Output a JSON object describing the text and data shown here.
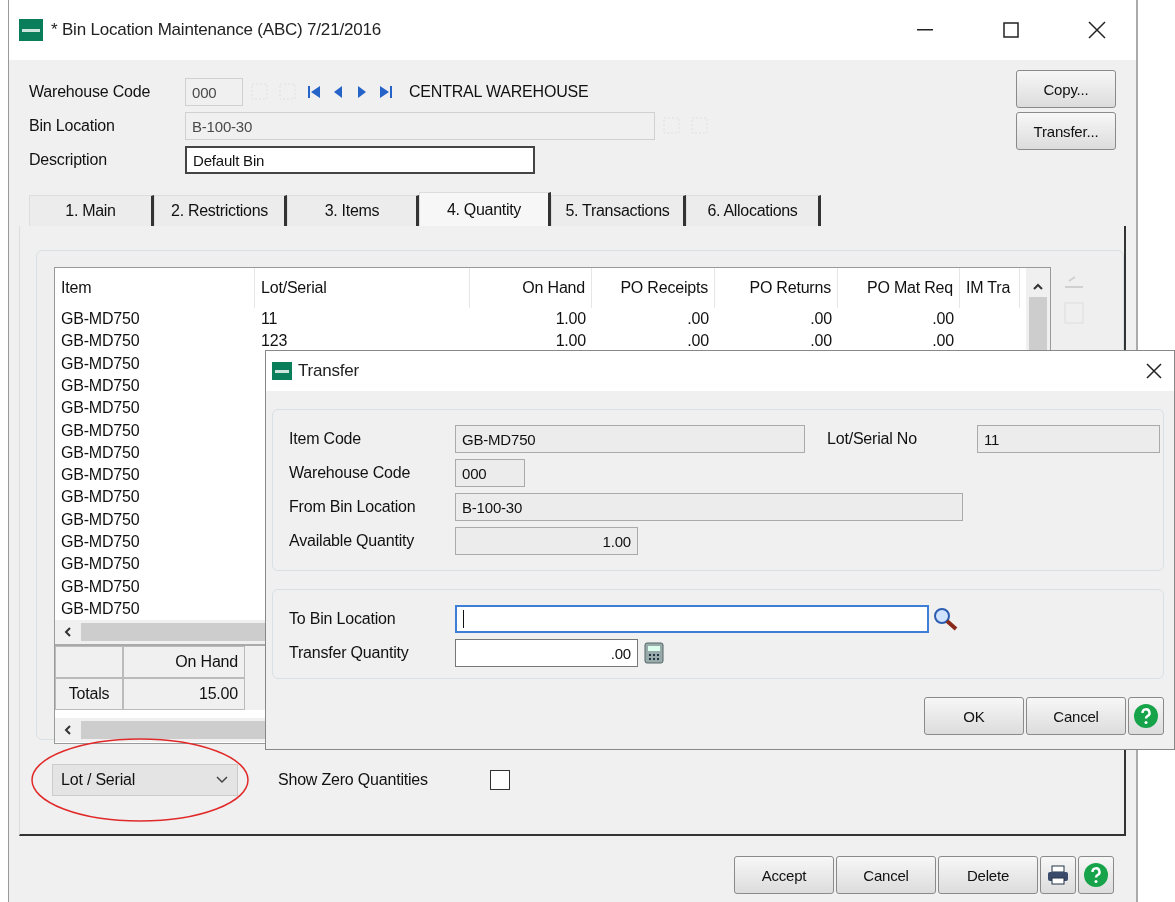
{
  "window": {
    "title": "* Bin Location Maintenance (ABC) 7/21/2016"
  },
  "header": {
    "warehouse_code": {
      "label": "Warehouse Code",
      "value": "000",
      "name": "CENTRAL WAREHOUSE"
    },
    "bin_location": {
      "label": "Bin Location",
      "value": "B-100-30"
    },
    "description": {
      "label": "Description",
      "value": "Default Bin"
    }
  },
  "side_buttons": [
    "Copy...",
    "Transfer..."
  ],
  "tabs": [
    {
      "label": "1. Main",
      "selected": false
    },
    {
      "label": "2. Restrictions",
      "selected": false
    },
    {
      "label": "3. Items",
      "selected": false
    },
    {
      "label": "4. Quantity",
      "selected": true
    },
    {
      "label": "5. Transactions",
      "selected": false
    },
    {
      "label": "6. Allocations",
      "selected": false
    }
  ],
  "grid": {
    "columns": [
      "Item",
      "Lot/Serial",
      "On Hand",
      "PO Receipts",
      "PO Returns",
      "PO Mat Req",
      "IM Tra"
    ],
    "rows": [
      {
        "cells": [
          "GB-MD750",
          "11",
          "1.00",
          ".00",
          ".00",
          ".00"
        ]
      },
      {
        "cells": [
          "GB-MD750",
          "123",
          "1.00",
          ".00",
          ".00",
          ".00"
        ]
      },
      {
        "cells": [
          "GB-MD750"
        ]
      },
      {
        "cells": [
          "GB-MD750"
        ]
      },
      {
        "cells": [
          "GB-MD750"
        ]
      },
      {
        "cells": [
          "GB-MD750"
        ]
      },
      {
        "cells": [
          "GB-MD750"
        ]
      },
      {
        "cells": [
          "GB-MD750"
        ]
      },
      {
        "cells": [
          "GB-MD750"
        ]
      },
      {
        "cells": [
          "GB-MD750"
        ]
      },
      {
        "cells": [
          "GB-MD750"
        ]
      },
      {
        "cells": [
          "GB-MD750"
        ]
      },
      {
        "cells": [
          "GB-MD750"
        ]
      },
      {
        "cells": [
          "GB-MD750"
        ]
      }
    ]
  },
  "totals": {
    "column": "On Hand",
    "label": "Totals",
    "value": "15.00"
  },
  "view_select": {
    "value": "Lot / Serial",
    "circled": true
  },
  "show_zero": {
    "label": "Show Zero Quantities",
    "checked": false
  },
  "footer_buttons": [
    "Accept",
    "Cancel",
    "Delete"
  ],
  "dialog": {
    "title": "Transfer",
    "item_code": {
      "label": "Item Code",
      "value": "GB-MD750"
    },
    "lot_serial_no": {
      "label": "Lot/Serial No",
      "value": "11"
    },
    "warehouse_code": {
      "label": "Warehouse Code",
      "value": "000"
    },
    "from_bin_location": {
      "label": "From Bin Location",
      "value": "B-100-30"
    },
    "available_quantity": {
      "label": "Available Quantity",
      "value": "1.00"
    },
    "to_bin_location": {
      "label": "To Bin Location",
      "focused": true
    },
    "transfer_quantity": {
      "label": "Transfer Quantity",
      "value": ".00"
    },
    "buttons": [
      "OK",
      "Cancel"
    ]
  }
}
